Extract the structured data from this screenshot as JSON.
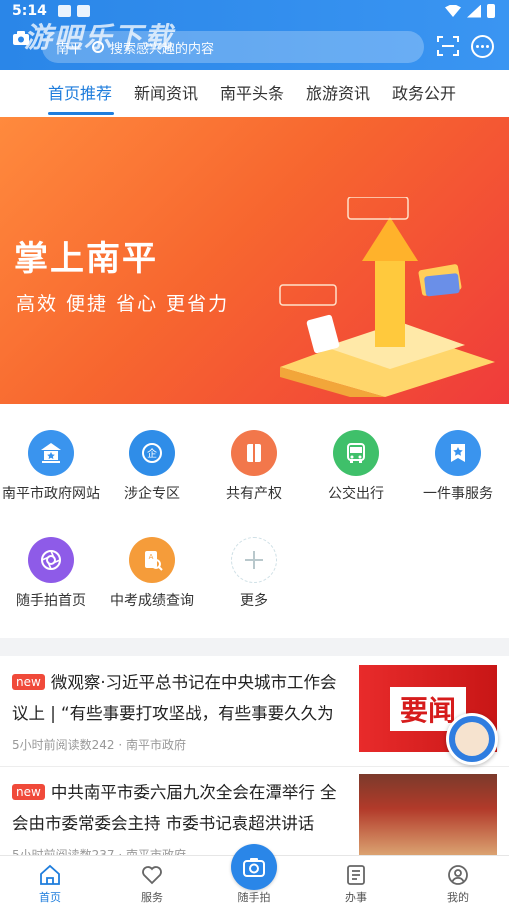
{
  "status": {
    "time": "5:14"
  },
  "header": {
    "watermark": "游吧乐下载",
    "search_city": "南平",
    "search_placeholder": "搜索感兴趣的内容"
  },
  "tabs": [
    "首页推荐",
    "新闻资讯",
    "南平头条",
    "旅游资讯",
    "政务公开"
  ],
  "banner": {
    "title": "掌上南平",
    "subtitle": "高效 便捷 省心 更省力"
  },
  "grid": [
    {
      "label": "南平市政府网站",
      "icon": "government-building-icon",
      "color": "#3a94ee"
    },
    {
      "label": "涉企专区",
      "icon": "enterprise-icon",
      "color": "#2f8de8"
    },
    {
      "label": "共有产权",
      "icon": "property-icon",
      "color": "#f2774b"
    },
    {
      "label": "公交出行",
      "icon": "bus-icon",
      "color": "#3fc06a"
    },
    {
      "label": "一件事服务",
      "icon": "star-badge-icon",
      "color": "#3a94ee"
    },
    {
      "label": "随手拍首页",
      "icon": "camera-aperture-icon",
      "color": "#8e5be8"
    },
    {
      "label": "中考成绩查询",
      "icon": "exam-search-icon",
      "color": "#f59c3a"
    },
    {
      "label": "更多",
      "icon": "plus-icon",
      "color": "#cfe0e6"
    }
  ],
  "news": [
    {
      "tag": "new",
      "title": "微观察·习近平总书记在中央城市工作会议上 | “有些事要打攻坚战，有些事要久久为",
      "meta": "5小时前阅读数242 · 南平市政府",
      "thumb_text": "要闻"
    },
    {
      "tag": "new",
      "title": "中共南平市委六届九次全会在潭举行 全会由市委常委会主持 市委书记袁超洪讲话",
      "meta": "5小时前阅读数237 · 南平市政府"
    }
  ],
  "bottom_nav": [
    {
      "label": "首页",
      "active": true
    },
    {
      "label": "服务",
      "active": false
    },
    {
      "label": "随手拍",
      "active": false
    },
    {
      "label": "办事",
      "active": false
    },
    {
      "label": "我的",
      "active": false
    }
  ]
}
